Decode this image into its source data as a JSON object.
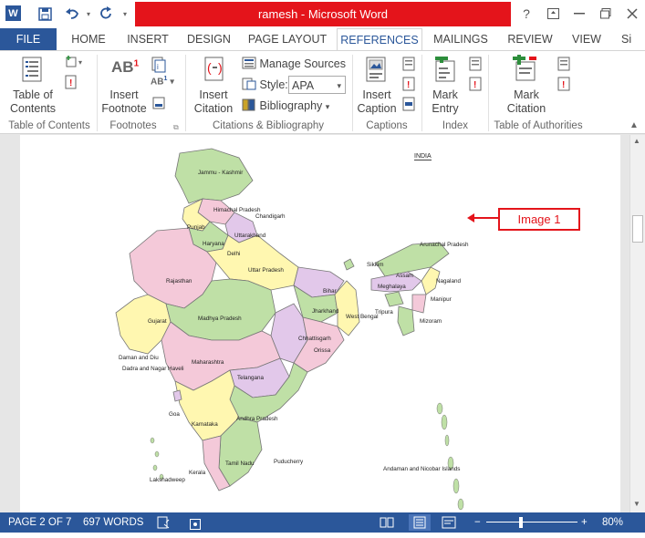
{
  "window": {
    "title": "ramesh  -  Microsoft Word"
  },
  "tabs": {
    "file": "FILE",
    "home": "HOME",
    "insert": "INSERT",
    "design": "DESIGN",
    "page_layout": "PAGE LAYOUT",
    "references": "REFERENCES",
    "mailings": "MAILINGS",
    "review": "REVIEW",
    "view": "VIEW",
    "overflow": "Si"
  },
  "ribbon": {
    "toc": {
      "btn_line1": "Table of",
      "btn_line2": "Contents",
      "group": "Table of Contents"
    },
    "footnotes": {
      "btn_line1": "Insert",
      "btn_line2": "Footnote",
      "group": "Footnotes",
      "icon_text": "AB",
      "icon_sup": "1"
    },
    "citations": {
      "btn_line1": "Insert",
      "btn_line2": "Citation",
      "manage_sources": "Manage Sources",
      "style_label": "Style:",
      "style_value": "APA",
      "bibliography": "Bibliography",
      "group": "Citations & Bibliography"
    },
    "captions": {
      "btn_line1": "Insert",
      "btn_line2": "Caption",
      "group": "Captions"
    },
    "index": {
      "btn_line1": "Mark",
      "btn_line2": "Entry",
      "group": "Index"
    },
    "authorities": {
      "btn_line1": "Mark",
      "btn_line2": "Citation",
      "group": "Table of Authorities"
    }
  },
  "document": {
    "map_title": "INDIA",
    "callout": "Image 1",
    "labels": [
      "Jammu - Kashmir",
      "Himachal Pradesh",
      "Chandigarh",
      "Punjab",
      "Uttarakhand",
      "Haryana",
      "Delhi",
      "Uttar Pradesh",
      "Rajasthan",
      "Sikkim",
      "Arunachal Pradesh",
      "Assam",
      "Nagaland",
      "Meghalaya",
      "Manipur",
      "Bihar",
      "Jharkhand",
      "West Bengal",
      "Tripura",
      "Mizoram",
      "Gujarat",
      "Madhya Pradesh",
      "Chhattisgarh",
      "Orissa",
      "Daman and Diu",
      "Dadra and Nagar Haveli",
      "Maharashtra",
      "Telangana",
      "Goa",
      "Karnataka",
      "Andhra Pradesh",
      "Tamil Nadu",
      "Puducherry",
      "Kerala",
      "Lakshadweep",
      "Andaman and Nicobar Islands"
    ]
  },
  "status": {
    "page": "PAGE 2 OF 7",
    "words": "697 WORDS",
    "zoom": "80%"
  },
  "colors": {
    "accent": "#2b579a",
    "title_red": "#e4141b"
  }
}
